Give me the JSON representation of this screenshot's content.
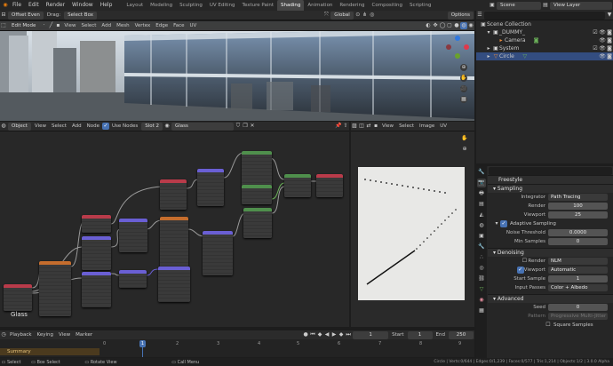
{
  "topbar": {
    "menus": [
      "File",
      "Edit",
      "Render",
      "Window",
      "Help"
    ],
    "workspaces": [
      "Layout",
      "Modeling",
      "Sculpting",
      "UV Editing",
      "Texture Paint",
      "Shading",
      "Animation",
      "Rendering",
      "Compositing",
      "Scripting"
    ],
    "active_workspace": "Shading",
    "scene": "Scene",
    "view_layer": "View Layer"
  },
  "tool_header": {
    "offset_mode": "Offset Even",
    "drag_label": "Drag:",
    "drag_value": "Select Box",
    "transform": "Global",
    "options": "Options"
  },
  "viewport_header": {
    "mode": "Edit Mode",
    "menus": [
      "View",
      "Select",
      "Add",
      "Mesh",
      "Vertex",
      "Edge",
      "Face",
      "UV"
    ]
  },
  "node_header": {
    "type": "Object",
    "menus": [
      "View",
      "Select",
      "Add",
      "Node"
    ],
    "use_nodes": "Use Nodes",
    "slot": "Slot 2",
    "material": "Glass"
  },
  "node_editor": {
    "material_label": "Glass",
    "nodes": [
      "UV Map",
      "Math Node",
      "Vector Math",
      "Math",
      "Math",
      "Mix RGB",
      "Mapping",
      "Color Ramp",
      "Layer Weight",
      "Fresnel",
      "Math",
      "Noise",
      "Combine XYZ",
      "Mix Shader",
      "Material Output",
      "Glossy BSDF",
      "Noise Texture",
      "Principled"
    ]
  },
  "image_header": {
    "menus": [
      "View",
      "Select",
      "Image",
      "UV"
    ]
  },
  "timeline": {
    "menus": [
      "Playback",
      "Keying",
      "View",
      "Marker"
    ],
    "current_frame": "1",
    "start_label": "Start",
    "start": "1",
    "end_label": "End",
    "end": "250",
    "ticks": [
      "0",
      "1",
      "2",
      "3",
      "4",
      "5",
      "6",
      "7",
      "8",
      "9"
    ],
    "summary": "Summary",
    "marker": "1"
  },
  "status": {
    "select": "Select",
    "box_select": "Box Select",
    "rotate": "Rotate View",
    "call_menu": "Call Menu",
    "stats": "Circle | Verts:0/644 | Edges:0/1,239 | Faces:0/577 | Tris:1,214 | Objects:1/2 | 3.0.0 Alpha"
  },
  "outliner": {
    "items": [
      {
        "label": "Scene Collection",
        "depth": 0
      },
      {
        "label": "_DUMMY_",
        "depth": 1
      },
      {
        "label": "Camera",
        "depth": 2
      },
      {
        "label": "System",
        "depth": 1
      },
      {
        "label": "Circle",
        "depth": 1
      }
    ]
  },
  "properties": {
    "freestyle": "Freestyle",
    "sampling": "Sampling",
    "integrator_k": "Integrator",
    "integrator_v": "Path Tracing",
    "render_k": "Render",
    "render_v": "100",
    "viewport_k": "Viewport",
    "viewport_v": "25",
    "adaptive": "Adaptive Sampling",
    "noise_k": "Noise Threshold",
    "noise_v": "0.0000",
    "min_k": "Min Samples",
    "min_v": "0",
    "denoising": "Denoising",
    "den_render_k": "Render",
    "den_render_v": "NLM",
    "den_view_k": "Viewport",
    "den_view_v": "Automatic",
    "start_sample_k": "Start Sample",
    "start_sample_v": "1",
    "input_passes_k": "Input Passes",
    "input_passes_v": "Color + Albedo",
    "advanced": "Advanced",
    "seed_k": "Seed",
    "seed_v": "0",
    "pattern_k": "Pattern",
    "pattern_v": "Progressive Multi-Jitter",
    "square": "Square Samples"
  }
}
